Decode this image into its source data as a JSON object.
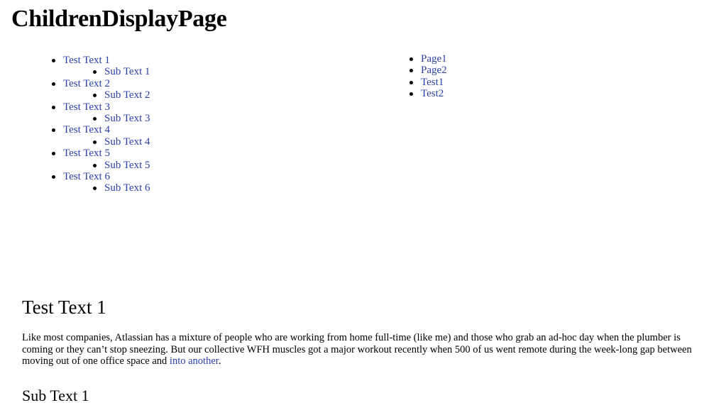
{
  "page": {
    "title": "ChildrenDisplayPage"
  },
  "left_tree": [
    {
      "label": "Test Text 1",
      "child": "Sub Text 1"
    },
    {
      "label": "Test Text 2",
      "child": "Sub Text 2"
    },
    {
      "label": "Test Text 3",
      "child": "Sub Text 3"
    },
    {
      "label": "Test Text 4",
      "child": "Sub Text 4"
    },
    {
      "label": "Test Text 5",
      "child": "Sub Text 5"
    },
    {
      "label": "Test Text 6",
      "child": "Sub Text 6"
    }
  ],
  "right_list": [
    "Page1",
    "Page2",
    "Test1",
    "Test2"
  ],
  "section": {
    "heading": "Test Text 1",
    "paragraph_before_link": "Like most companies, Atlassian has a mixture of people who are working from home full-time (like me) and those who grab an ad-hoc day when the plumber is coming or they can’t stop sneezing. But our collective WFH muscles got a major workout recently when 500 of us went remote during the week-long gap between moving out of one office space and ",
    "link_text": "into another",
    "paragraph_after_link": ".",
    "subheading": "Sub Text 1"
  },
  "colors": {
    "link": "#2a3fa8",
    "text": "#000000",
    "background": "#ffffff"
  }
}
